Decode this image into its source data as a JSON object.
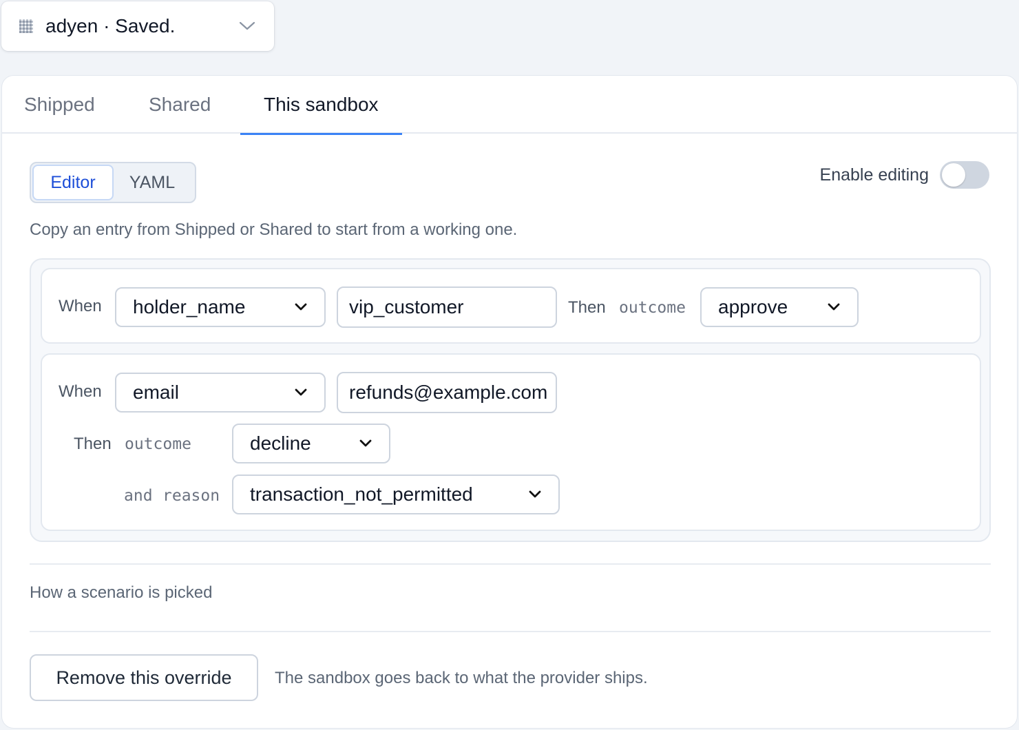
{
  "picker": {
    "label": "adyen · Saved.",
    "icon": "grid-icon"
  },
  "tabs": [
    {
      "label": "Shipped",
      "active": false
    },
    {
      "label": "Shared",
      "active": false
    },
    {
      "label": "This sandbox",
      "active": true
    }
  ],
  "mode": {
    "editor_label": "Editor",
    "yaml_label": "YAML",
    "selected": "Editor"
  },
  "editing": {
    "label": "Enable editing",
    "enabled": false
  },
  "hint": "Copy an entry from Shipped or Shared to start from a working one.",
  "rules": [
    {
      "when_label": "When",
      "field": "holder_name",
      "value": "vip_customer",
      "then_label": "Then",
      "outcome_label": "outcome",
      "outcome": "approve"
    },
    {
      "when_label": "When",
      "field": "email",
      "value": "refunds@example.com",
      "then_label": "Then",
      "outcome_label": "outcome",
      "outcome": "decline",
      "and_label": "and",
      "reason_label": "reason",
      "reason": "transaction_not_permitted"
    }
  ],
  "scenario_section": {
    "label": "How a scenario is picked"
  },
  "remove": {
    "button_label": "Remove this override",
    "note": "The sandbox goes back to what the provider ships."
  },
  "colors": {
    "accent": "#3b82f6",
    "active_tab_text": "#111827",
    "toggle_off": "#cfd6e0"
  }
}
